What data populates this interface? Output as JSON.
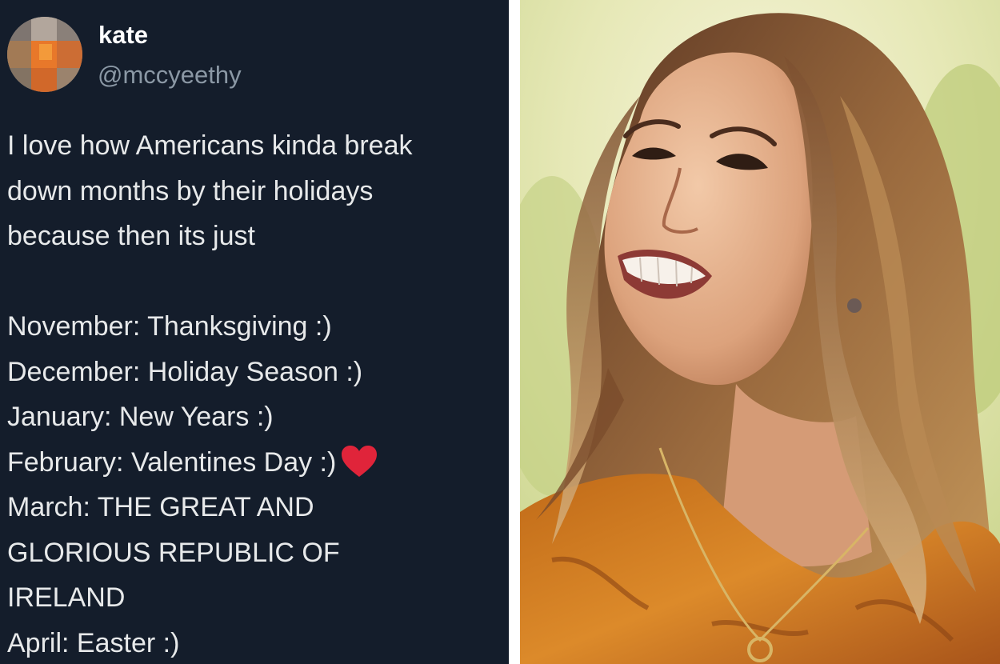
{
  "tweet": {
    "author": {
      "display_name": "kate",
      "handle": "@mccyeethy",
      "avatar_icon": "pixelated-avatar"
    },
    "intro_lines": [
      "I love how Americans kinda break",
      "down months by their holidays",
      "because then its just"
    ],
    "month_lines": [
      "November: Thanksgiving :)",
      "December: Holiday Season :)",
      "January: New Years :)",
      "February: Valentines Day :)",
      "March: THE GREAT AND",
      "GLORIOUS REPUBLIC OF",
      "IRELAND",
      "April: Easter :)"
    ],
    "emoji": {
      "name": "red-heart-icon",
      "color": "#e0243a"
    }
  },
  "photo": {
    "subject": "smiling-woman-photo"
  },
  "colors": {
    "tweet_background": "#141d2b",
    "primary_text": "#e7e9ea",
    "secondary_text": "#8b98a5",
    "divider": "#ffffff"
  }
}
